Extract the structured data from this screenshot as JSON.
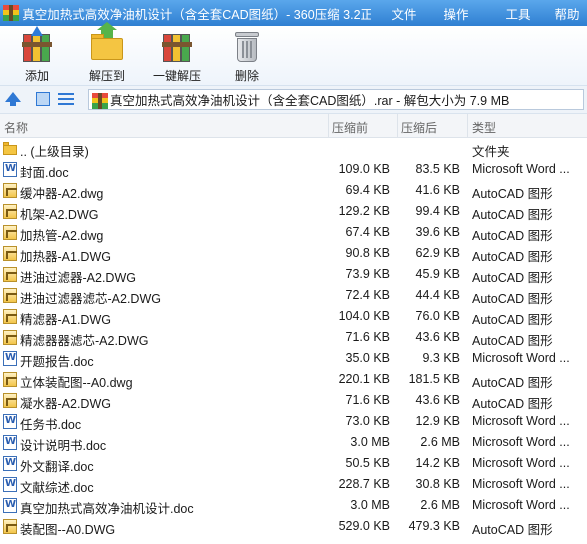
{
  "window": {
    "title": "真空加热式高效净油机设计（含全套CAD图纸）- 360压缩 3.2正式版",
    "menu": [
      "文件",
      "操作",
      "工具",
      "帮助"
    ]
  },
  "toolbar": {
    "add_label": "添加",
    "extract_to_label": "解压到",
    "one_click_extract_label": "一键解压",
    "delete_label": "删除"
  },
  "address": {
    "path": "真空加热式高效净油机设计（含全套CAD图纸）.rar - 解包大小为 7.9 MB"
  },
  "columns": {
    "name": "名称",
    "compressed": "压缩前",
    "packed": "压缩后",
    "type": "类型"
  },
  "files": [
    {
      "name": ".. (上级目录)",
      "size": "",
      "packed": "",
      "type": "文件夹",
      "icon": "folder-icon"
    },
    {
      "name": "封面.doc",
      "size": "109.0 KB",
      "packed": "83.5 KB",
      "type": "Microsoft Word ...",
      "icon": "word-doc-icon"
    },
    {
      "name": "缓冲器-A2.dwg",
      "size": "69.4 KB",
      "packed": "41.6 KB",
      "type": "AutoCAD 图形",
      "icon": "dwg-file-icon"
    },
    {
      "name": "机架-A2.DWG",
      "size": "129.2 KB",
      "packed": "99.4 KB",
      "type": "AutoCAD 图形",
      "icon": "dwg-file-icon"
    },
    {
      "name": "加热管-A2.dwg",
      "size": "67.4 KB",
      "packed": "39.6 KB",
      "type": "AutoCAD 图形",
      "icon": "dwg-file-icon"
    },
    {
      "name": "加热器-A1.DWG",
      "size": "90.8 KB",
      "packed": "62.9 KB",
      "type": "AutoCAD 图形",
      "icon": "dwg-file-icon"
    },
    {
      "name": "进油过滤器-A2.DWG",
      "size": "73.9 KB",
      "packed": "45.9 KB",
      "type": "AutoCAD 图形",
      "icon": "dwg-file-icon"
    },
    {
      "name": "进油过滤器滤芯-A2.DWG",
      "size": "72.4 KB",
      "packed": "44.4 KB",
      "type": "AutoCAD 图形",
      "icon": "dwg-file-icon"
    },
    {
      "name": "精滤器-A1.DWG",
      "size": "104.0 KB",
      "packed": "76.0 KB",
      "type": "AutoCAD 图形",
      "icon": "dwg-file-icon"
    },
    {
      "name": "精滤器器滤芯-A2.DWG",
      "size": "71.6 KB",
      "packed": "43.6 KB",
      "type": "AutoCAD 图形",
      "icon": "dwg-file-icon"
    },
    {
      "name": "开题报告.doc",
      "size": "35.0 KB",
      "packed": "9.3 KB",
      "type": "Microsoft Word ...",
      "icon": "word-doc-icon"
    },
    {
      "name": "立体装配图--A0.dwg",
      "size": "220.1 KB",
      "packed": "181.5 KB",
      "type": "AutoCAD 图形",
      "icon": "dwg-file-icon"
    },
    {
      "name": "凝水器-A2.DWG",
      "size": "71.6 KB",
      "packed": "43.6 KB",
      "type": "AutoCAD 图形",
      "icon": "dwg-file-icon"
    },
    {
      "name": "任务书.doc",
      "size": "73.0 KB",
      "packed": "12.9 KB",
      "type": "Microsoft Word ...",
      "icon": "word-doc-icon"
    },
    {
      "name": "设计说明书.doc",
      "size": "3.0 MB",
      "packed": "2.6 MB",
      "type": "Microsoft Word ...",
      "icon": "word-doc-icon"
    },
    {
      "name": "外文翻译.doc",
      "size": "50.5 KB",
      "packed": "14.2 KB",
      "type": "Microsoft Word ...",
      "icon": "word-doc-icon"
    },
    {
      "name": "文献综述.doc",
      "size": "228.7 KB",
      "packed": "30.8 KB",
      "type": "Microsoft Word ...",
      "icon": "word-doc-icon"
    },
    {
      "name": "真空加热式高效净油机设计.doc",
      "size": "3.0 MB",
      "packed": "2.6 MB",
      "type": "Microsoft Word ...",
      "icon": "word-doc-icon"
    },
    {
      "name": "装配图--A0.DWG",
      "size": "529.0 KB",
      "packed": "479.3 KB",
      "type": "AutoCAD 图形",
      "icon": "dwg-file-icon"
    }
  ]
}
